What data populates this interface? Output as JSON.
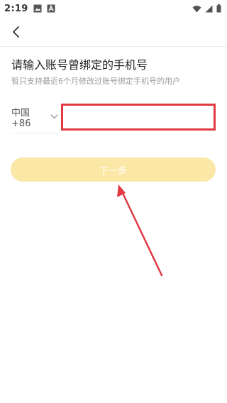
{
  "status_bar": {
    "time": "2:19",
    "icons": [
      "image-icon",
      "app-a-icon",
      "wifi-icon",
      "signal-icon",
      "battery-icon"
    ]
  },
  "nav": {
    "back_icon": "chevron-left-icon"
  },
  "main": {
    "title": "请输入账号曾绑定的手机号",
    "subtitle": "暂只支持最近6个月修改过账号绑定手机号的用户",
    "country_code": "中国+86",
    "phone_value": "",
    "next_label": "下一步"
  },
  "colors": {
    "button_bg": "#fbe8a6",
    "highlight": "#e13a44"
  }
}
